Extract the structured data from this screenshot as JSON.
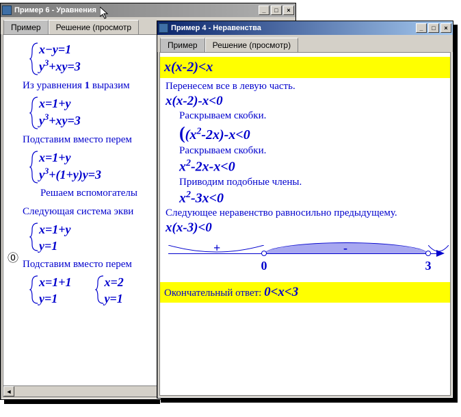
{
  "win1": {
    "title": "Пример 6 - Уравнения",
    "tabs": {
      "t1": "Пример",
      "t2": "Решение (просмотр"
    },
    "l_eq1a": "x−y=1",
    "l_eq1b": "y",
    "l_eq1b_exp": "3",
    "l_eq1b_rest": "+xy=3",
    "l_text1": "Из уравнения ",
    "l_text1_num": "1",
    "l_text1_rest": " выразим",
    "l_eq2a": "x=1+y",
    "l_eq2b": "y",
    "l_eq2b_exp": "3",
    "l_eq2b_rest": "+xy=3",
    "l_text2": "Подставим вместо перем",
    "l_eq3a": "x=1+y",
    "l_eq3b": "y",
    "l_eq3b_exp": "3",
    "l_eq3b_rest": "+(1+y)y=3",
    "l_text3": "Решаем вспомогателы",
    "l_text4": "Следующая система экви",
    "l_eq4a": "x=1+y",
    "l_eq4b": "y=1",
    "l_text5": "Подставим вместо перем",
    "l_eq5a": "x=1+1",
    "l_eq5b": "y=1",
    "l_eq6a": "x=2",
    "l_eq6b": "y=1"
  },
  "win2": {
    "title": "Пример 4 - Неравенства",
    "tabs": {
      "t1": "Пример",
      "t2": "Решение (просмотр)"
    },
    "r_main": "x(x-2)<x",
    "r_text1": "Перенесем все в левую часть.",
    "r_eq1": "x(x-2)-x<0",
    "r_text2": "Раскрываем скобки.",
    "r_eq2a": "(x",
    "r_eq2a_exp": "2",
    "r_eq2a_rest": "-2x)",
    "r_eq2b": "-x<0",
    "r_text3": "Раскрываем скобки.",
    "r_eq3a": "x",
    "r_eq3a_exp": "2",
    "r_eq3a_rest": "-2x-x<0",
    "r_text4": "Приводим подобные члены.",
    "r_eq4a": "x",
    "r_eq4a_exp": "2",
    "r_eq4a_rest": "-3x<0",
    "r_text5": "Следующее неравенство равносильно предыдущему.",
    "r_eq5": "x(x-3)<0",
    "r_answer_label": "Окончательный ответ:  ",
    "r_answer": "0<x<3",
    "numline": {
      "plus": "+",
      "minus": "-",
      "zero": "0",
      "three": "3"
    }
  },
  "chart_data": {
    "type": "numberline",
    "title": "Sign chart for x(x-3)",
    "points": [
      0,
      3
    ],
    "intervals": [
      {
        "from": "-inf",
        "to": 0,
        "sign": "+",
        "shaded": false
      },
      {
        "from": 0,
        "to": 3,
        "sign": "-",
        "shaded": true
      },
      {
        "from": 3,
        "to": "+inf",
        "sign": "+",
        "shaded": false
      }
    ],
    "open_points": [
      0,
      3
    ],
    "xlabel": "",
    "ylabel": ""
  }
}
